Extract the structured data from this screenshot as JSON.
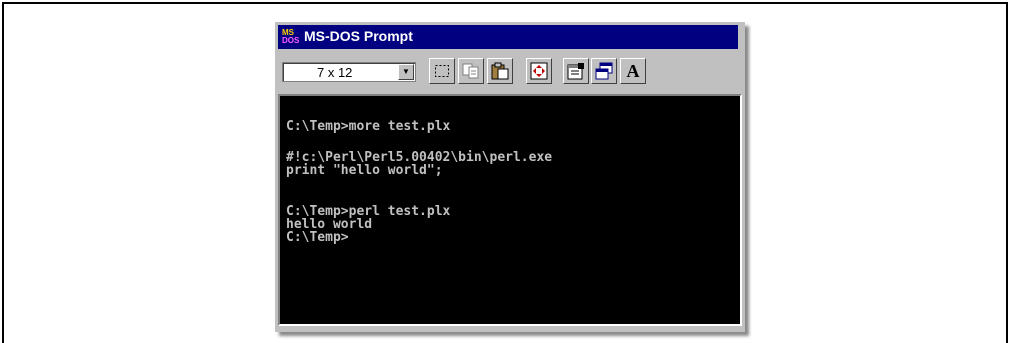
{
  "window": {
    "title": "MS-DOS Prompt",
    "icon_text_top": "MS",
    "icon_text_bottom": "DOS"
  },
  "toolbar": {
    "font_size_value": "7 x 12",
    "buttons": [
      {
        "name": "mark-icon"
      },
      {
        "name": "copy-icon"
      },
      {
        "name": "paste-icon"
      },
      {
        "name": "fullscreen-icon"
      },
      {
        "name": "properties-icon"
      },
      {
        "name": "background-icon"
      },
      {
        "name": "font-icon",
        "label": "A"
      }
    ]
  },
  "terminal": {
    "lines": [
      "C:\\Temp>more test.plx",
      "#!c:\\Perl\\Perl5.00402\\bin\\perl.exe",
      "print \"hello world\";",
      "C:\\Temp>perl test.plx",
      "hello world",
      "C:\\Temp>"
    ]
  }
}
